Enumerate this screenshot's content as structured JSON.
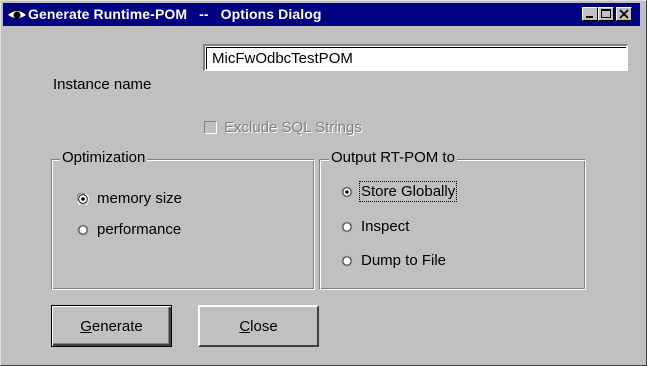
{
  "window": {
    "title": "Generate Runtime-POM   --   Options Dialog",
    "title_bg_color": "#000080",
    "face_color": "#c0c0c0"
  },
  "instance": {
    "label": "Instance name",
    "value": "MicFwOdbcTestPOM"
  },
  "exclude_sql": {
    "label": "Exclude SQL Strings",
    "checked": false,
    "enabled": false
  },
  "optimization": {
    "title": "Optimization",
    "options": [
      {
        "label": "memory size",
        "selected": true
      },
      {
        "label": "performance",
        "selected": false
      }
    ]
  },
  "output": {
    "title": "Output RT-POM to",
    "options": [
      {
        "label": "Store Globally",
        "selected": true
      },
      {
        "label": "Inspect",
        "selected": false
      },
      {
        "label": "Dump to File",
        "selected": false
      }
    ]
  },
  "buttons": {
    "generate_first": "G",
    "generate_rest": "enerate",
    "close_first": "C",
    "close_rest": "lose"
  },
  "icons": [
    "eye-icon",
    "minimize-icon",
    "maximize-icon",
    "close-icon"
  ]
}
